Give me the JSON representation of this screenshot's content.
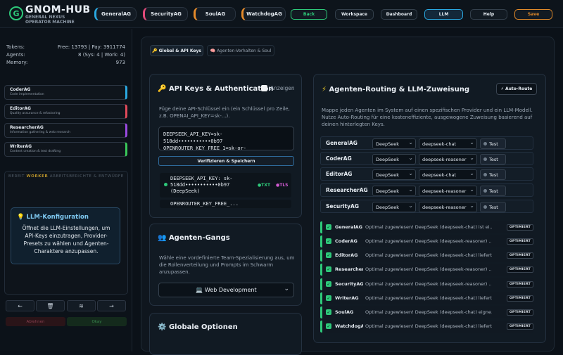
{
  "brand": {
    "title": "GNOM-HUB",
    "subtitle": "GENERAL NEXUS OPERATOR MACHINE",
    "logo_letter": "G"
  },
  "agent_tabs": [
    {
      "label": "GeneralAG",
      "color": "#2aa8e0"
    },
    {
      "label": "SecurityAG",
      "color": "#e04a7a"
    },
    {
      "label": "SoulAG",
      "color": "#e58a2a"
    },
    {
      "label": "WatchdogAG",
      "color": "#e58a2a"
    }
  ],
  "nav": {
    "back": "Back",
    "workspace": "Workspace",
    "dashboard": "Dashboard",
    "llm": "LLM",
    "help": "Help",
    "save": "Save"
  },
  "stats": {
    "tokens_label": "Tokens:",
    "tokens_value": "Free: 13793 | Pay: 3911774",
    "agents_label": "Agents:",
    "agents_value": "8 (Sys: 4 | Work: 4)",
    "memory_label": "Memory:",
    "memory_value": "973"
  },
  "agents": [
    {
      "name": "CoderAG",
      "desc": "Code implementation",
      "color": "#2aa8e0"
    },
    {
      "name": "EditorAG",
      "desc": "Quality assurance & refactoring",
      "color": "#e04a5a"
    },
    {
      "name": "ResearcherAG",
      "desc": "Information gathering & web research",
      "color": "#9a4ae0"
    },
    {
      "name": "WriterAG",
      "desc": "Content creation & text drafting",
      "color": "#3ac85a"
    }
  ],
  "worker_panel": {
    "tab_prefix": "BEREIT",
    "tab_worker": "WORKER",
    "tab_rest": "ARBEITSBERICHTE & ENTWÜRFE",
    "info_title": "LLM-Konfiguration",
    "info_text": "Öffnet die LLM-Einstellungen, um API-Keys einzutragen, Provider-Presets zu wählen und Agenten-Charaktere anzupassen."
  },
  "bottom_buttons": {
    "left": "←",
    "trash": "🗑",
    "layers": "≋",
    "right": "→",
    "reject": "Ablehnen",
    "okay": "Okay"
  },
  "subtabs": {
    "api": "🔑 Global & API Keys",
    "behavior": "🧠 Agenten-Verhalten & Soul"
  },
  "api_keys": {
    "title": "API Keys & Authentication",
    "show_label": "Anzeigen",
    "desc": "Füge deine API-Schlüssel ein (ein Schlüssel pro Zeile, z.B. OPENAI_API_KEY=sk-...).",
    "textarea_line1": "DEEPSEEK_API_KEY=sk-",
    "textarea_line2": "518dd•••••••••••0b97",
    "textarea_line3": "OPENROUTER_KEY_FREE_1=sk-or-",
    "verify_button": "Verifizieren & Speichern",
    "key1_line1": "DEEPSEEK_API_KEY: sk-",
    "key1_line2": "518dd•••••••••••0b97",
    "key1_line3": "(DeepSeek)",
    "key1_txt": "TXT",
    "key1_tls": "TLS",
    "key2_line1": "OPENROUTER_KEY_FREE_..."
  },
  "gangs": {
    "title": "Agenten-Gangs",
    "desc": "Wähle eine vordefinierte Team-Spezialisierung aus, um die Rollenverteilung und Prompts im Schwarm anzupassen.",
    "selected": "💻 Web Development"
  },
  "global_options": {
    "title": "Globale Optionen"
  },
  "routing": {
    "title": "Agenten-Routing & LLM-Zuweisung",
    "auto_button": "⚡ Auto-Route",
    "desc": "Mappe jeden Agenten im System auf einen spezifischen Provider und ein LLM-Modell. Nutze Auto-Routing für eine kosteneffiziente, ausgewogene Zuweisung basierend auf deinen hinterlegten Keys.",
    "test_label": "Test",
    "rows": [
      {
        "agent": "GeneralAG",
        "provider": "DeepSeek",
        "model": "deepseek-chat"
      },
      {
        "agent": "CoderAG",
        "provider": "DeepSeek",
        "model": "deepseek-reasoner"
      },
      {
        "agent": "EditorAG",
        "provider": "DeepSeek",
        "model": "deepseek-chat"
      },
      {
        "agent": "ResearcherAG",
        "provider": "DeepSeek",
        "model": "deepseek-reasoner"
      },
      {
        "agent": "SecurityAG",
        "provider": "DeepSeek",
        "model": "deepseek-reasoner"
      }
    ]
  },
  "log": {
    "tag": "OPTIMIERT",
    "rows": [
      {
        "agent": "GeneralAG",
        "msg": "Optimal zugewiesen! DeepSeek (deepseek-chat) ist ei..."
      },
      {
        "agent": "CoderAG",
        "msg": "Optimal zugewiesen! DeepSeek (deepseek-reasoner) ..."
      },
      {
        "agent": "EditorAG",
        "msg": "Optimal zugewiesen! DeepSeek (deepseek-chat) liefert..."
      },
      {
        "agent": "ResearcherAG",
        "msg": "Optimal zugewiesen! DeepSeek (deepseek-reasoner) ..."
      },
      {
        "agent": "SecurityAG",
        "msg": "Optimal zugewiesen! DeepSeek (deepseek-reasoner) ..."
      },
      {
        "agent": "WriterAG",
        "msg": "Optimal zugewiesen! DeepSeek (deepseek-chat) liefert..."
      },
      {
        "agent": "SoulAG",
        "msg": "Optimal zugewiesen! DeepSeek (deepseek-chat) eigne..."
      },
      {
        "agent": "WatchdogAG",
        "msg": "Optimal zugewiesen! DeepSeek (deepseek-chat) liefert..."
      }
    ]
  },
  "colors": {
    "accent": "#2ec97a",
    "save": "#e08a2a",
    "llm": "#2aa8e0"
  }
}
